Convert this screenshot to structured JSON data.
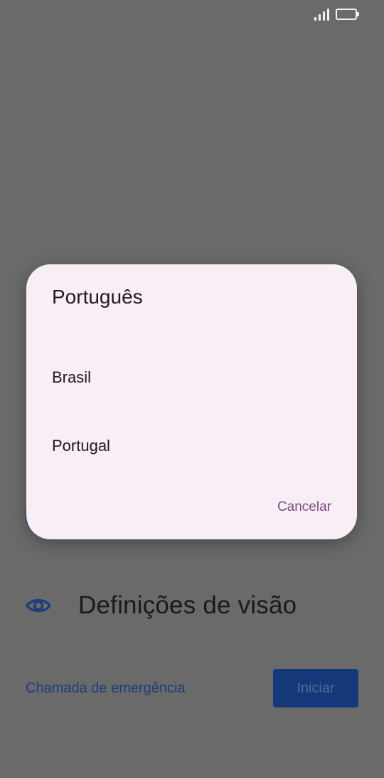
{
  "status_bar": {
    "signal_icon": "signal-bars-icon",
    "battery_icon": "battery-icon"
  },
  "background": {
    "vision_settings_label": "Definições de visão",
    "vision_icon": "eye-icon",
    "emergency_call_label": "Chamada de emergência",
    "start_button_label": "Iniciar"
  },
  "dialog": {
    "title": "Português",
    "options": [
      {
        "label": "Brasil"
      },
      {
        "label": "Portugal"
      }
    ],
    "cancel_label": "Cancelar"
  },
  "colors": {
    "scrim": "#6a6a6a",
    "dialog_bg": "#f8eef5",
    "accent_text": "#7a4a85",
    "primary_blue": "#15387a"
  }
}
